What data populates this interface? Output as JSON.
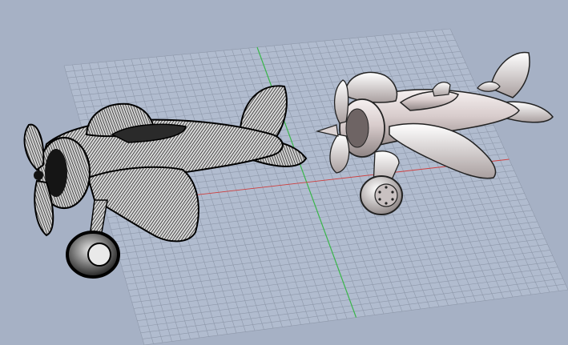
{
  "viewport": {
    "background": "#a6b1c5",
    "grid_color": "#8e98aa",
    "grid_axis_y_color": "#39b54a",
    "grid_axis_x_color": "#d04040"
  },
  "models": [
    {
      "name": "airplane-wireframe",
      "display_mode": "wireframe"
    },
    {
      "name": "airplane-shaded",
      "display_mode": "shaded"
    }
  ]
}
